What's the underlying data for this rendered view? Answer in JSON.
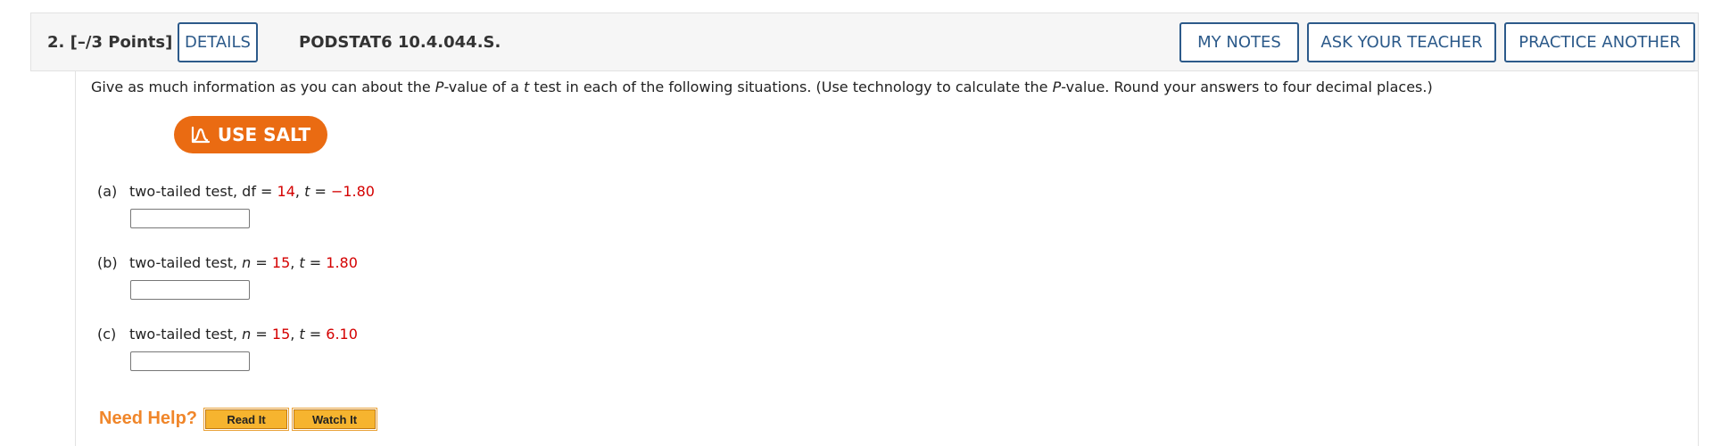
{
  "header": {
    "question_number": "2.",
    "points": "[–/3 Points]",
    "details_label": "DETAILS",
    "problem_code": "PODSTAT6 10.4.044.S.",
    "my_notes_label": "MY NOTES",
    "ask_teacher_label": "ASK YOUR TEACHER",
    "practice_another_label": "PRACTICE ANOTHER"
  },
  "instructions": {
    "t1": "Give as much information as you can about the ",
    "p1": "P",
    "t2": "-value of a ",
    "t_var": "t",
    "t3": " test in each of the following situations. (Use technology to calculate the ",
    "p2": "P",
    "t4": "-value. Round your answers to four decimal places.)"
  },
  "salt": {
    "label": "USE SALT",
    "icon": "salt-distribution-icon"
  },
  "parts": [
    {
      "label": "(a)",
      "text": "two-tailed test, ",
      "param": "df",
      "eq1": " = ",
      "param_value": "14",
      "sep": ", ",
      "t_name": "t",
      "eq2": " = ",
      "t_value": "−1.80",
      "answer": ""
    },
    {
      "label": "(b)",
      "text": "two-tailed test, ",
      "param": "n",
      "eq1": " = ",
      "param_value": "15",
      "sep": ", ",
      "t_name": "t",
      "eq2": " = ",
      "t_value": "1.80",
      "answer": ""
    },
    {
      "label": "(c)",
      "text": "two-tailed test, ",
      "param": "n",
      "eq1": " = ",
      "param_value": "15",
      "sep": ", ",
      "t_name": "t",
      "eq2": " = ",
      "t_value": "6.10",
      "answer": ""
    }
  ],
  "help": {
    "label": "Need Help?",
    "read_label": "Read It",
    "watch_label": "Watch It"
  },
  "colors": {
    "accent_blue": "#2c5a8a",
    "salt_orange": "#ea6b12",
    "value_red": "#d40000",
    "help_orange": "#f0862a",
    "help_button": "#f6b42f"
  }
}
